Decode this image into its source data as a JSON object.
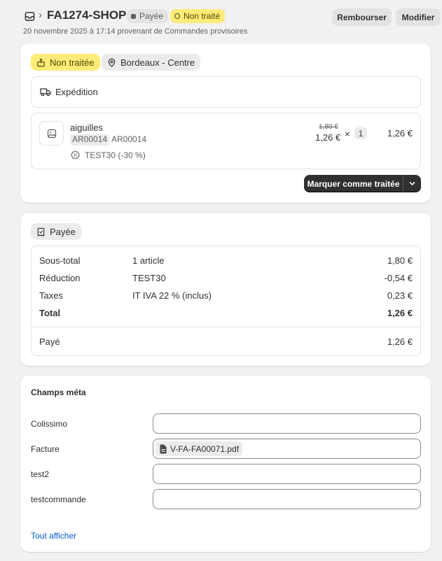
{
  "header": {
    "order_id": "FA1274-SHOP",
    "breadcrumb_sep": "›",
    "payment_badge": "Payée",
    "fulfillment_badge": "Non traité",
    "subtitle": "20 novembre 2025 à 17:14 provenant de Commandes provisoires",
    "refund_label": "Rembourser",
    "edit_label": "Modifier"
  },
  "fulfillment": {
    "status": "Non traitée",
    "location": "Bordeaux - Centre",
    "shipping_label": "Expédition",
    "item": {
      "name": "aiguilles",
      "sku_tag": "AR00014",
      "sku": "AR00014",
      "discount": "TEST30 (-30 %)",
      "original_price": "1,80 €",
      "unit_price": "1,26 €",
      "times": "×",
      "quantity": "1",
      "total": "1,26 €"
    },
    "mark_button": "Marquer comme traitée"
  },
  "payment": {
    "status": "Payée",
    "rows": [
      {
        "label": "Sous-total",
        "detail": "1 article",
        "amount": "1,80 €"
      },
      {
        "label": "Réduction",
        "detail": "TEST30",
        "amount": "-0,54 €"
      },
      {
        "label": "Taxes",
        "detail": "IT IVA 22 % (inclus)",
        "amount": "0,23 €"
      },
      {
        "label": "Total",
        "detail": "",
        "amount": "1,26 €"
      }
    ],
    "paid_label": "Payé",
    "paid_amount": "1,26 €"
  },
  "metafields": {
    "title": "Champs méta",
    "fields": [
      {
        "label": "Colissimo",
        "value": ""
      },
      {
        "label": "Facture",
        "value": "V-FA-FA00071.pdf"
      },
      {
        "label": "test2",
        "value": ""
      },
      {
        "label": "testcommande",
        "value": ""
      }
    ],
    "show_all": "Tout afficher"
  }
}
